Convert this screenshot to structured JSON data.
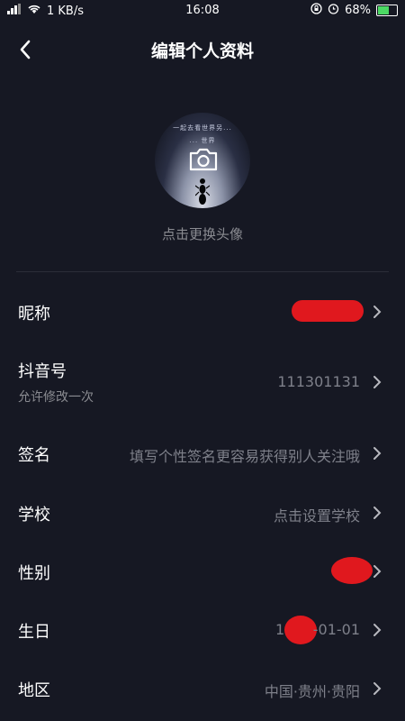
{
  "status_bar": {
    "signal": "⁴ᴳ",
    "speed": "1 KB/s",
    "time": "16:08",
    "battery": "68%",
    "battery_level": 0.68
  },
  "nav": {
    "title": "编辑个人资料"
  },
  "avatar": {
    "text_line1": "一起去看世界另...",
    "text_line2": "... 世界",
    "change_label": "点击更换头像"
  },
  "fields": {
    "nickname_label": "昵称",
    "douyin_id_label": "抖音号",
    "douyin_id_value": "111301131",
    "douyin_id_hint": "允许修改一次",
    "signature_label": "签名",
    "signature_placeholder": "填写个性签名更容易获得别人关注哦",
    "school_label": "学校",
    "school_placeholder": "点击设置学校",
    "gender_label": "性别",
    "birthday_label": "生日",
    "birthday_value_prefix": "1",
    "birthday_value_suffix": "-01-01",
    "region_label": "地区",
    "region_value": "中国·贵州·贵阳"
  }
}
